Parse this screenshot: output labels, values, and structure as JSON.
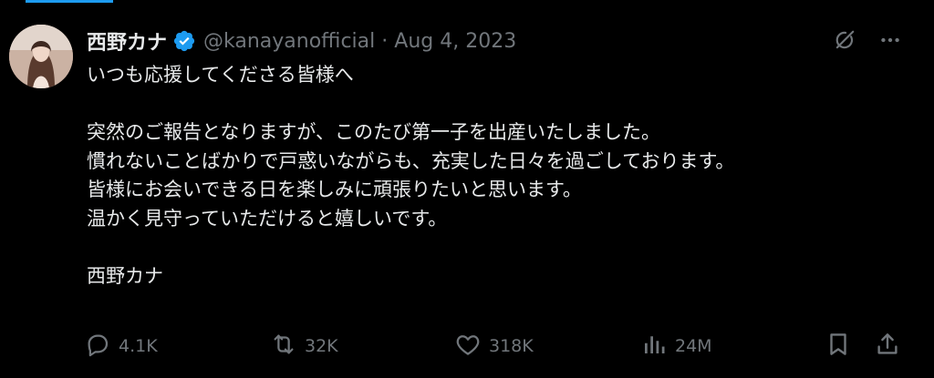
{
  "colors": {
    "background": "#000000",
    "text": "#e7e9ea",
    "muted": "#71767b",
    "verified": "#1d9bf0"
  },
  "tweet": {
    "author": {
      "display_name": "西野カナ",
      "handle": "@kanayanofficial",
      "verified": true
    },
    "separator": "·",
    "date": "Aug 4, 2023",
    "body_lines": [
      "いつも応援してくださる皆様へ",
      "",
      "突然のご報告となりますが、このたび第一子を出産いたしました。",
      "慣れないことばかりで戸惑いながらも、充実した日々を過ごしております。",
      "皆様にお会いできる日を楽しみに頑張りたいと思います。",
      "温かく見守っていただけると嬉しいです。",
      "",
      "西野カナ"
    ],
    "stats": {
      "replies": "4.1K",
      "reposts": "32K",
      "likes": "318K",
      "views": "24M"
    },
    "icons": {
      "grok": "grok-icon",
      "more": "more-icon",
      "reply": "reply-icon",
      "repost": "repost-icon",
      "like": "like-icon",
      "views": "views-icon",
      "bookmark": "bookmark-icon",
      "share": "share-icon",
      "verified": "verified-badge-icon"
    }
  }
}
